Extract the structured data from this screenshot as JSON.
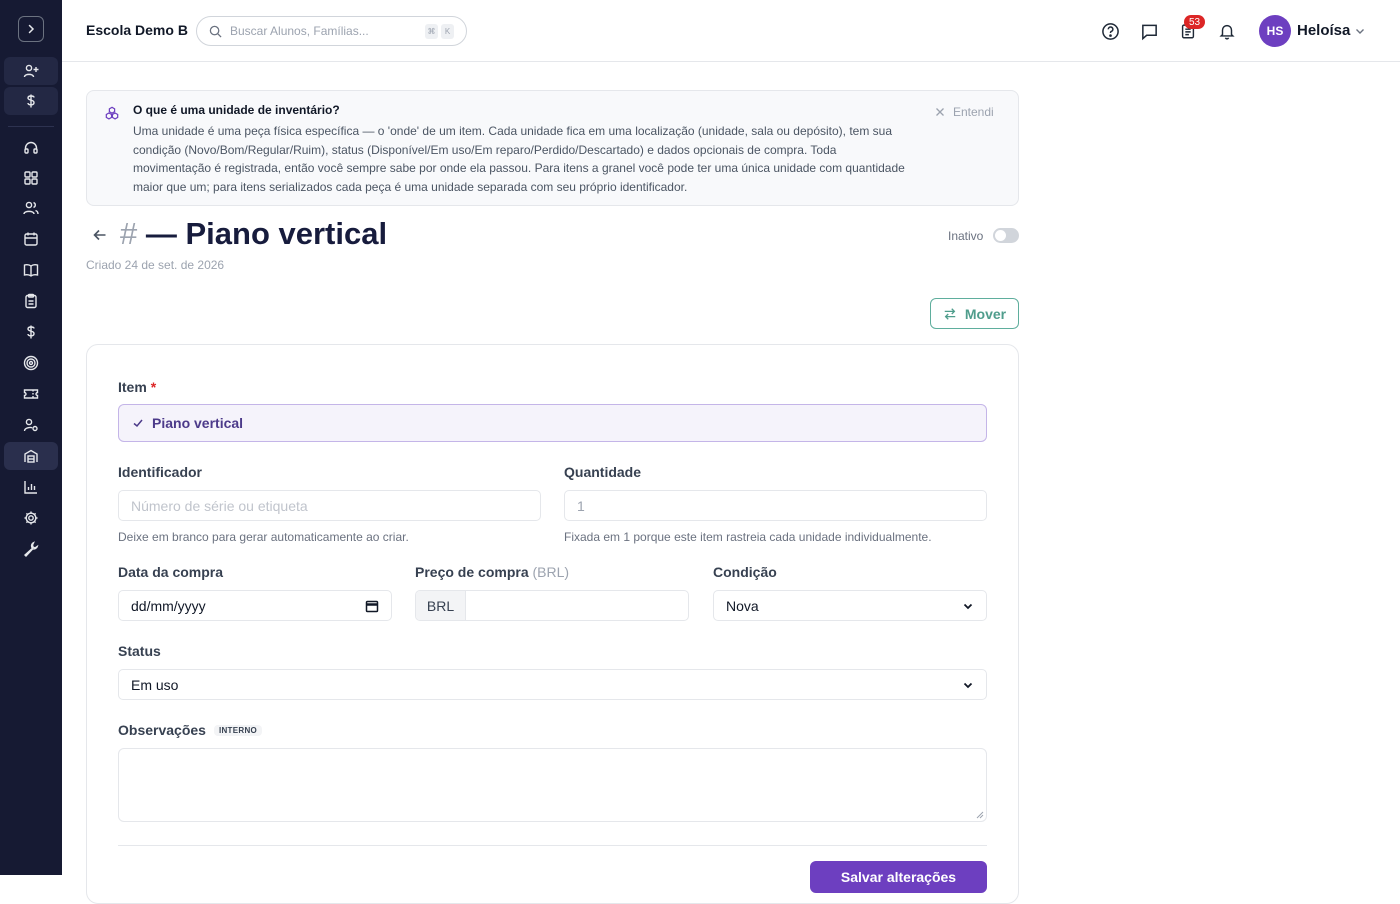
{
  "topbar": {
    "school_name": "Escola Demo B",
    "search_placeholder": "Buscar Alunos, Famílias...",
    "kbd_cmd": "⌘",
    "kbd_k": "K",
    "tasks_badge": "53",
    "user_initials": "HS",
    "user_name": "Heloísa"
  },
  "sidebar": {
    "items": [
      "user-plus-icon",
      "dollar-icon",
      "headset-icon",
      "dashboard-icon",
      "users-icon",
      "calendar-icon",
      "book-icon",
      "clipboard-icon",
      "dollar-icon",
      "target-icon",
      "ticket-icon",
      "user-cog-icon",
      "inventory-icon",
      "chart-icon",
      "settings-icon",
      "wrench-icon"
    ],
    "active": "inventory-icon"
  },
  "info": {
    "title": "O que é uma unidade de inventário?",
    "body": "Uma unidade é uma peça física específica — o 'onde' de um item. Cada unidade fica em uma localização (unidade, sala ou depósito), tem sua condição (Novo/Bom/Regular/Ruim), status (Disponível/Em uso/Em reparo/Perdido/Descartado) e dados opcionais de compra. Toda movimentação é registrada, então você sempre sabe por onde ela passou. Para itens a granel você pode ter uma única unidade com quantidade maior que um; para itens serializados cada peça é uma unidade separada com seu próprio identificador.",
    "dismiss": "Entendi"
  },
  "header": {
    "hash": "#",
    "title": " — Piano vertical",
    "created": "Criado 24 de set. de 2026",
    "inactive_label": "Inativo",
    "move_label": "Mover"
  },
  "form": {
    "item_label": "Item",
    "required_mark": "*",
    "item_value": "Piano vertical",
    "identifier_label": "Identificador",
    "identifier_placeholder": "Número de série ou etiqueta",
    "identifier_help": "Deixe em branco para gerar automaticamente ao criar.",
    "quantity_label": "Quantidade",
    "quantity_value": "1",
    "quantity_help": "Fixada em 1 porque este item rastreia cada unidade individualmente.",
    "purchase_date_label": "Data da compra",
    "purchase_date_value": "dd/mm/yyyy",
    "price_label": "Preço de compra",
    "price_currency_note": "(BRL)",
    "currency": "BRL",
    "condition_label": "Condição",
    "condition_value": "Nova",
    "status_label": "Status",
    "status_value": "Em uso",
    "notes_label": "Observações",
    "notes_tag": "INTERNO",
    "save_label": "Salvar alterações"
  },
  "colors": {
    "sidebar_bg": "#161a33",
    "accent": "#6d3fc0",
    "move_green": "#4f9d8c",
    "badge_red": "#dc2626"
  }
}
